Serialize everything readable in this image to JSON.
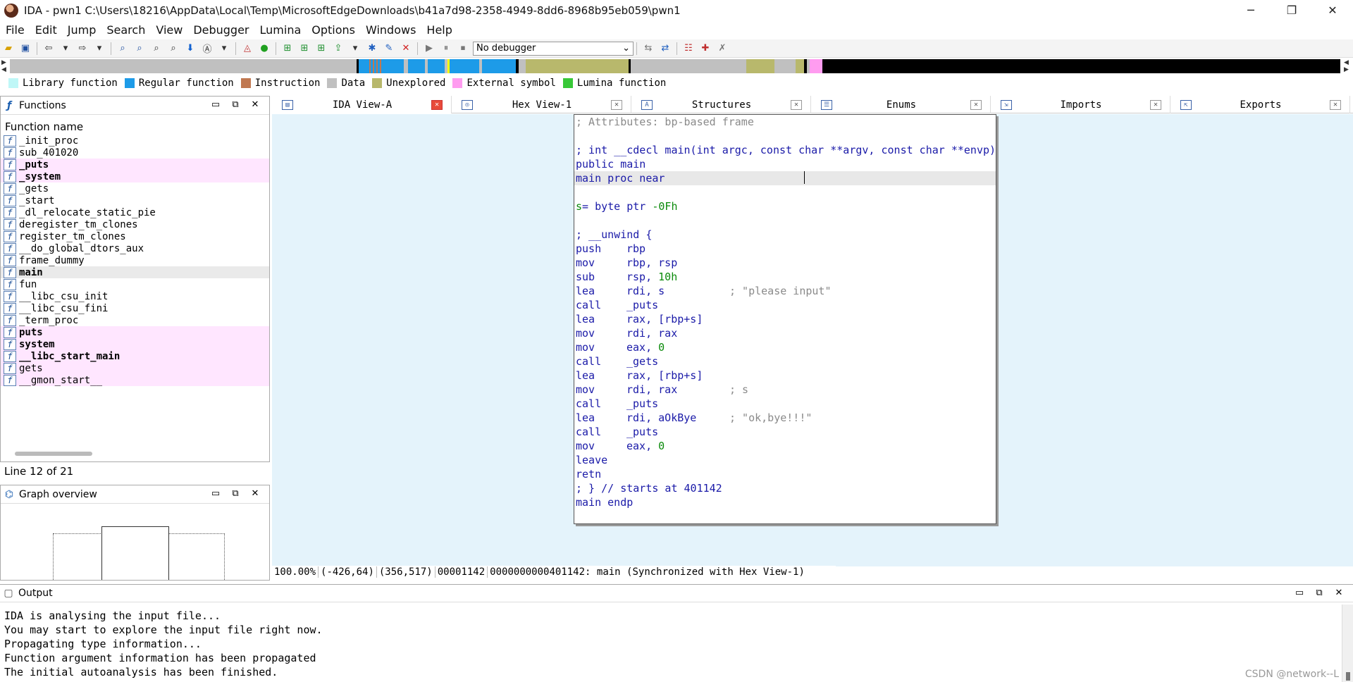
{
  "window": {
    "title": "IDA - pwn1 C:\\Users\\18216\\AppData\\Local\\Temp\\MicrosoftEdgeDownloads\\b41a7d98-2358-4949-8dd6-8968b95eb059\\pwn1",
    "minimize": "─",
    "restore": "❐",
    "close": "✕"
  },
  "menu": [
    "File",
    "Edit",
    "Jump",
    "Search",
    "View",
    "Debugger",
    "Lumina",
    "Options",
    "Windows",
    "Help"
  ],
  "toolbar": {
    "debugger_select": "No debugger"
  },
  "legend": [
    {
      "label": "Library function",
      "color": "#bff7f7"
    },
    {
      "label": "Regular function",
      "color": "#1d9be8"
    },
    {
      "label": "Instruction",
      "color": "#c07850"
    },
    {
      "label": "Data",
      "color": "#c0c0c0"
    },
    {
      "label": "Unexplored",
      "color": "#b8b86c"
    },
    {
      "label": "External symbol",
      "color": "#ff9cf0"
    },
    {
      "label": "Lumina function",
      "color": "#38c838"
    }
  ],
  "functions_panel": {
    "title": "Functions",
    "column": "Function name",
    "items": [
      {
        "name": "_init_proc",
        "ext": false,
        "bold": false
      },
      {
        "name": "sub_401020",
        "ext": false,
        "bold": false
      },
      {
        "name": "_puts",
        "ext": true,
        "bold": true
      },
      {
        "name": "_system",
        "ext": true,
        "bold": true
      },
      {
        "name": "_gets",
        "ext": false,
        "bold": false
      },
      {
        "name": "_start",
        "ext": false,
        "bold": false
      },
      {
        "name": "_dl_relocate_static_pie",
        "ext": false,
        "bold": false
      },
      {
        "name": "deregister_tm_clones",
        "ext": false,
        "bold": false
      },
      {
        "name": "register_tm_clones",
        "ext": false,
        "bold": false
      },
      {
        "name": "__do_global_dtors_aux",
        "ext": false,
        "bold": false
      },
      {
        "name": "frame_dummy",
        "ext": false,
        "bold": false
      },
      {
        "name": "main",
        "ext": false,
        "bold": true
      },
      {
        "name": "fun",
        "ext": false,
        "bold": false
      },
      {
        "name": "__libc_csu_init",
        "ext": false,
        "bold": false
      },
      {
        "name": "__libc_csu_fini",
        "ext": false,
        "bold": false
      },
      {
        "name": "_term_proc",
        "ext": false,
        "bold": false
      },
      {
        "name": "puts",
        "ext": true,
        "bold": true
      },
      {
        "name": "system",
        "ext": true,
        "bold": true
      },
      {
        "name": "__libc_start_main",
        "ext": true,
        "bold": true
      },
      {
        "name": "gets",
        "ext": true,
        "bold": false
      },
      {
        "name": "__gmon_start__",
        "ext": true,
        "bold": false
      }
    ],
    "line_info": "Line 12 of 21"
  },
  "graph_panel": {
    "title": "Graph overview"
  },
  "tabs": [
    "IDA View-A",
    "Hex View-1",
    "Structures",
    "Enums",
    "Imports",
    "Exports"
  ],
  "code": {
    "attr": "; Attributes: bp-based frame",
    "proto": "; int __cdecl main(int argc, const char **argv, const char **envp)",
    "public": "public main",
    "proc": "main proc near",
    "var_name": "s",
    "var_def": "= byte ptr -0Fh",
    "unwind": "; __unwind {",
    "instructions": [
      {
        "op": "push",
        "args": "rbp",
        "cmt": ""
      },
      {
        "op": "mov",
        "args": "rbp, rsp",
        "cmt": ""
      },
      {
        "op": "sub",
        "args": "rsp, 10h",
        "cmt": ""
      },
      {
        "op": "lea",
        "args": "rdi, s",
        "cmt": "; \"please input\""
      },
      {
        "op": "call",
        "args": "_puts",
        "cmt": ""
      },
      {
        "op": "lea",
        "args": "rax, [rbp+s]",
        "cmt": ""
      },
      {
        "op": "mov",
        "args": "rdi, rax",
        "cmt": ""
      },
      {
        "op": "mov",
        "args": "eax, 0",
        "cmt": ""
      },
      {
        "op": "call",
        "args": "_gets",
        "cmt": ""
      },
      {
        "op": "lea",
        "args": "rax, [rbp+s]",
        "cmt": ""
      },
      {
        "op": "mov",
        "args": "rdi, rax",
        "cmt": "; s"
      },
      {
        "op": "call",
        "args": "_puts",
        "cmt": ""
      },
      {
        "op": "lea",
        "args": "rdi, aOkBye",
        "cmt": "; \"ok,bye!!!\""
      },
      {
        "op": "call",
        "args": "_puts",
        "cmt": ""
      },
      {
        "op": "mov",
        "args": "eax, 0",
        "cmt": ""
      },
      {
        "op": "leave",
        "args": "",
        "cmt": ""
      },
      {
        "op": "retn",
        "args": "",
        "cmt": ""
      }
    ],
    "end_unwind": "; } // starts at 401142",
    "endp": "main endp"
  },
  "status": {
    "zoom": "100.00%",
    "coord1": "(-426,64)",
    "coord2": "(356,517)",
    "offset": "00001142",
    "address": "0000000000401142: main (Synchronized with Hex View-1)"
  },
  "output": {
    "title": "Output",
    "lines": [
      "IDA is analysing the input file...",
      "You may start to explore the input file right now.",
      "Propagating type information...",
      "Function argument information has been propagated",
      "The initial autoanalysis has been finished."
    ]
  },
  "watermark": "CSDN @network--L"
}
